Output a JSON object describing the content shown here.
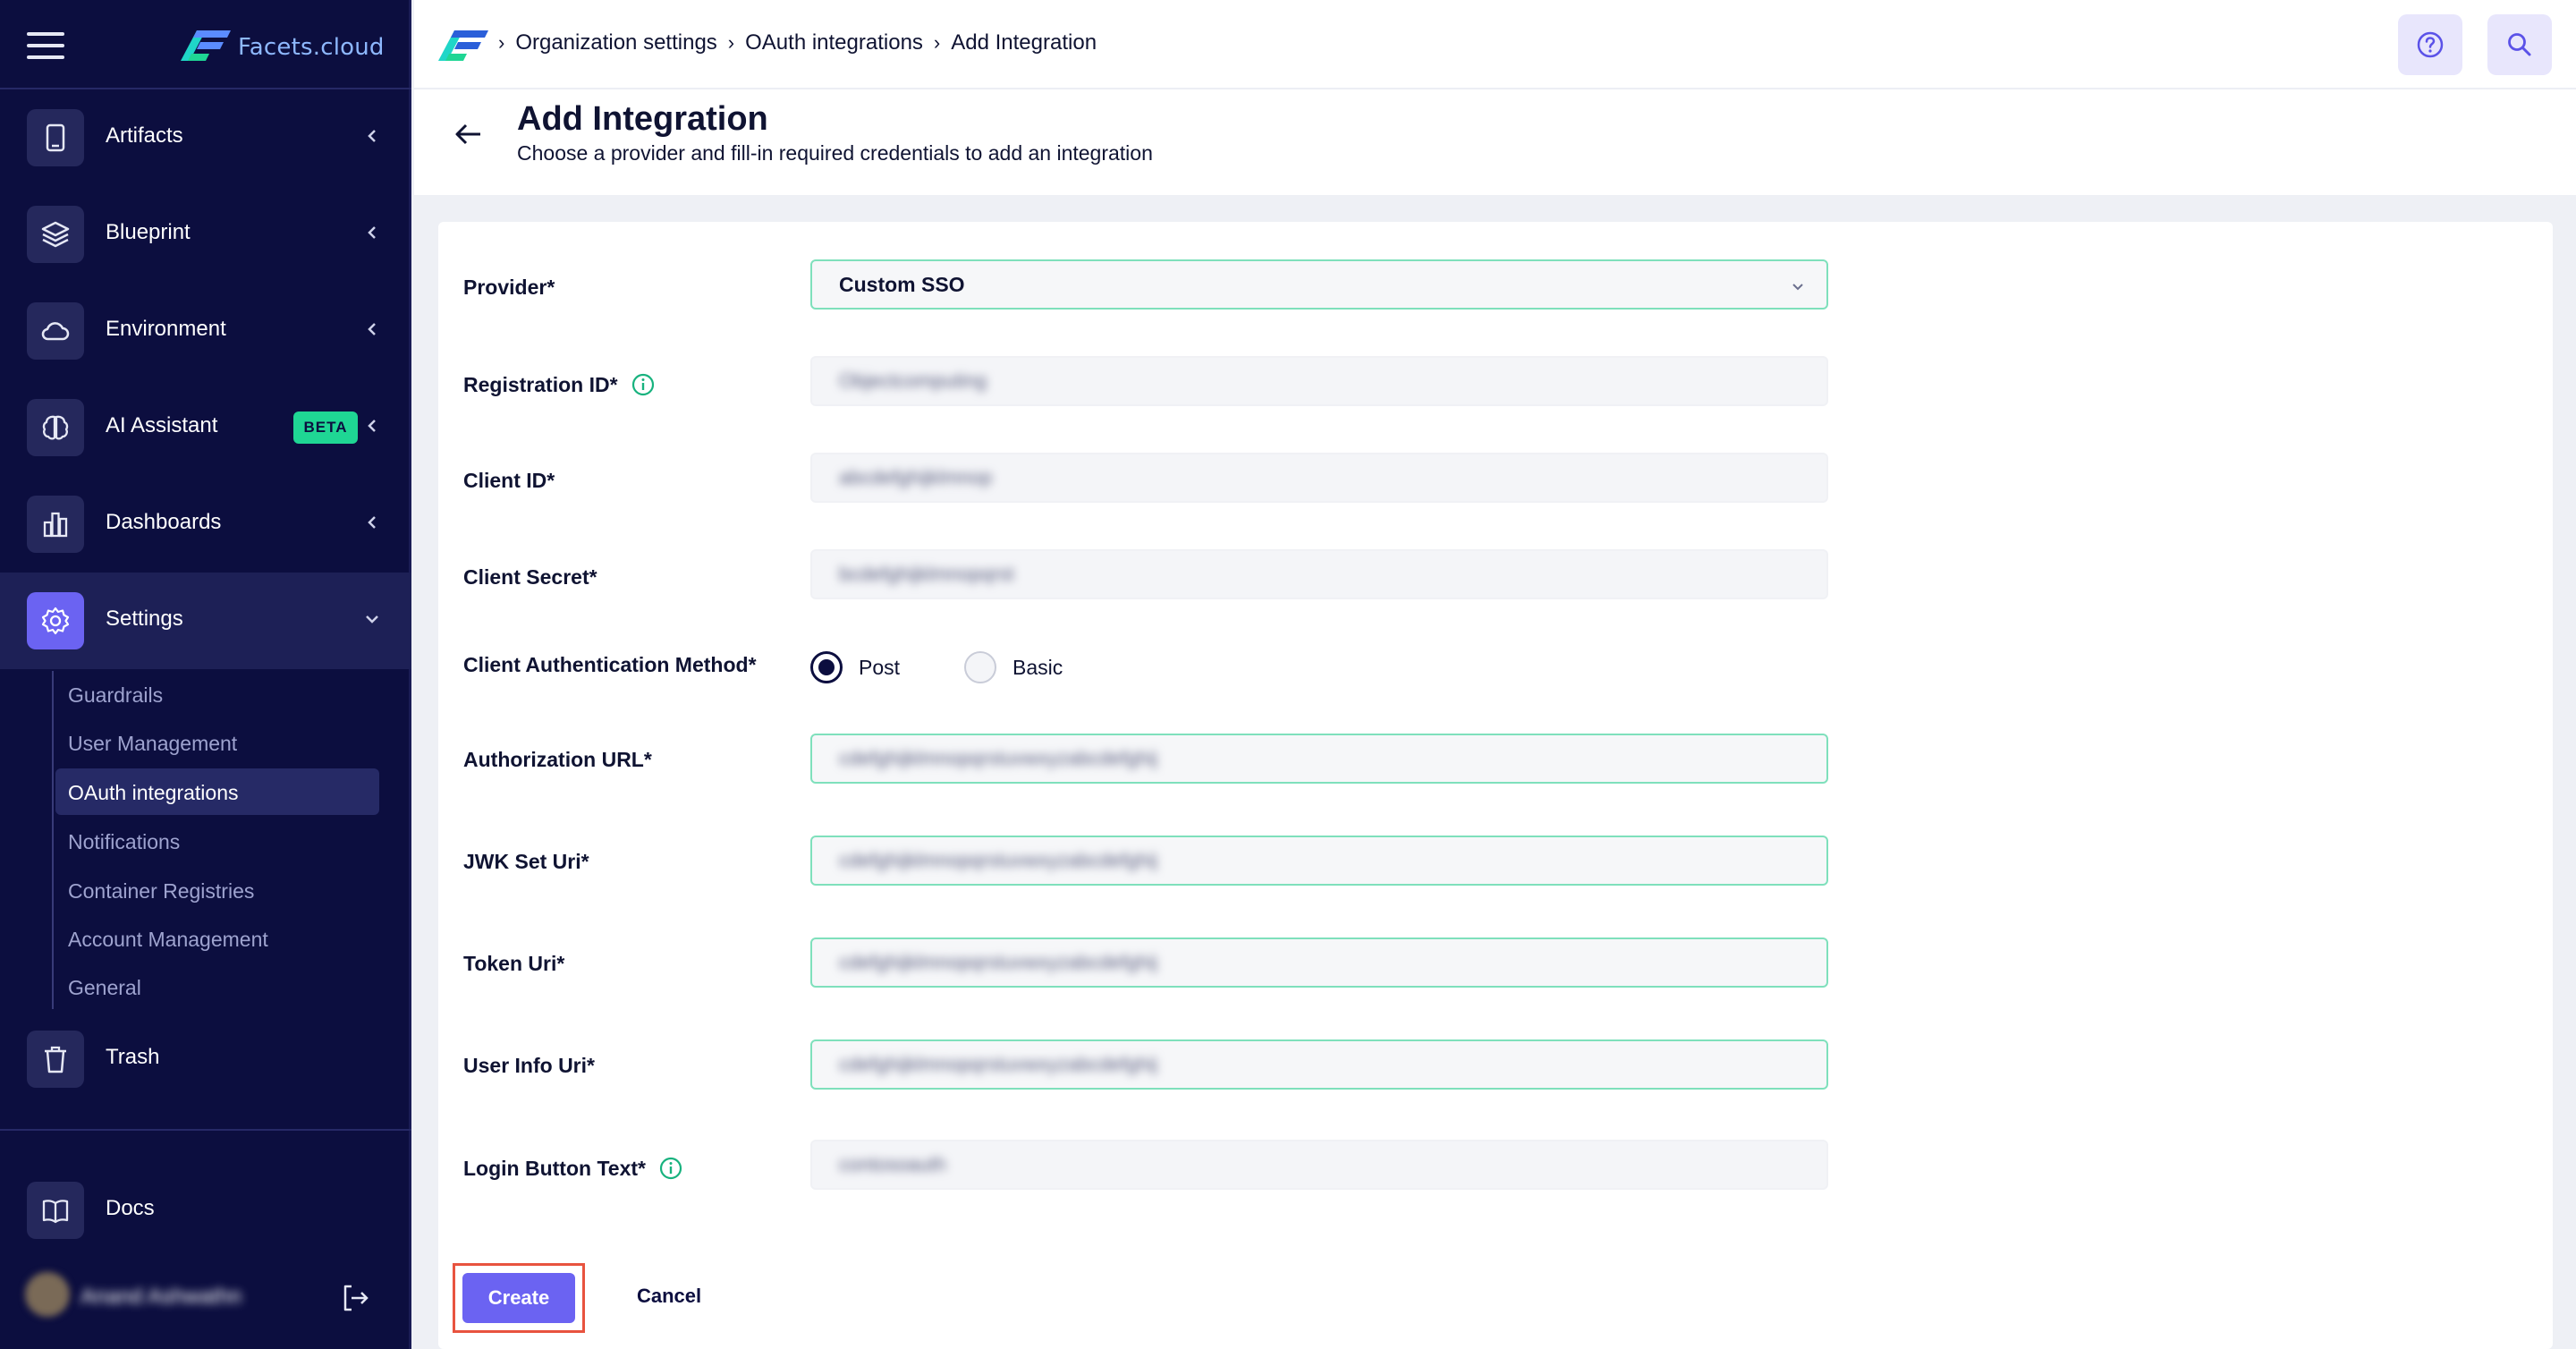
{
  "sidebar": {
    "brand": "Facets.cloud",
    "nav": [
      {
        "label": "Artifacts",
        "icon": "tablet-icon"
      },
      {
        "label": "Blueprint",
        "icon": "layers-icon"
      },
      {
        "label": "Environment",
        "icon": "cloud-icon"
      },
      {
        "label": "AI Assistant",
        "icon": "brain-icon",
        "badge": "BETA"
      },
      {
        "label": "Dashboards",
        "icon": "bar-chart-icon"
      },
      {
        "label": "Settings",
        "icon": "gear-icon"
      },
      {
        "label": "Trash",
        "icon": "trash-icon"
      },
      {
        "label": "Docs",
        "icon": "book-icon"
      }
    ],
    "settings_sub": [
      {
        "label": "Guardrails"
      },
      {
        "label": "User Management"
      },
      {
        "label": "OAuth integrations"
      },
      {
        "label": "Notifications"
      },
      {
        "label": "Container Registries"
      },
      {
        "label": "Account Management"
      },
      {
        "label": "General"
      }
    ],
    "user_name": "Anand Ashwathn"
  },
  "header": {
    "breadcrumb": [
      "Organization settings",
      "OAuth integrations",
      "Add Integration"
    ],
    "separator": "›"
  },
  "page": {
    "title": "Add Integration",
    "subtitle": "Choose a provider and fill-in required credentials to add an integration"
  },
  "form": {
    "provider": {
      "label": "Provider*",
      "value": "Custom SSO"
    },
    "registration_id": {
      "label": "Registration ID*",
      "value": "Objectcomputing"
    },
    "client_id": {
      "label": "Client ID*",
      "value": "abcdefghijklmnop"
    },
    "client_secret": {
      "label": "Client Secret*",
      "value": "bcdefghijklmnopqrst"
    },
    "auth_method": {
      "label": "Client Authentication Method*",
      "options": [
        "Post",
        "Basic"
      ],
      "selected": "Post"
    },
    "authorization_url": {
      "label": "Authorization URL*",
      "value": "cdefghijklmnopqrstuvwxyzabcdefghij"
    },
    "jwk_set_uri": {
      "label": "JWK Set Uri*",
      "value": "cdefghijklmnopqrstuvwxyzabcdefghij"
    },
    "token_uri": {
      "label": "Token Uri*",
      "value": "cdefghijklmnopqrstuvwxyzabcdefghij"
    },
    "user_info_uri": {
      "label": "User Info Uri*",
      "value": "cdefghijklmnopqrstuvwxyzabcdefghij"
    },
    "login_button_text": {
      "label": "Login Button Text*",
      "value": "contosoauth"
    },
    "create_label": "Create",
    "cancel_label": "Cancel"
  },
  "colors": {
    "sidebar_bg": "#0c0e3f",
    "accent": "#6b63f2",
    "beta_badge": "#1fd694",
    "input_focus_border": "#7fe0bc",
    "info_icon": "#17b27e",
    "highlight_outline": "#e8533f"
  }
}
